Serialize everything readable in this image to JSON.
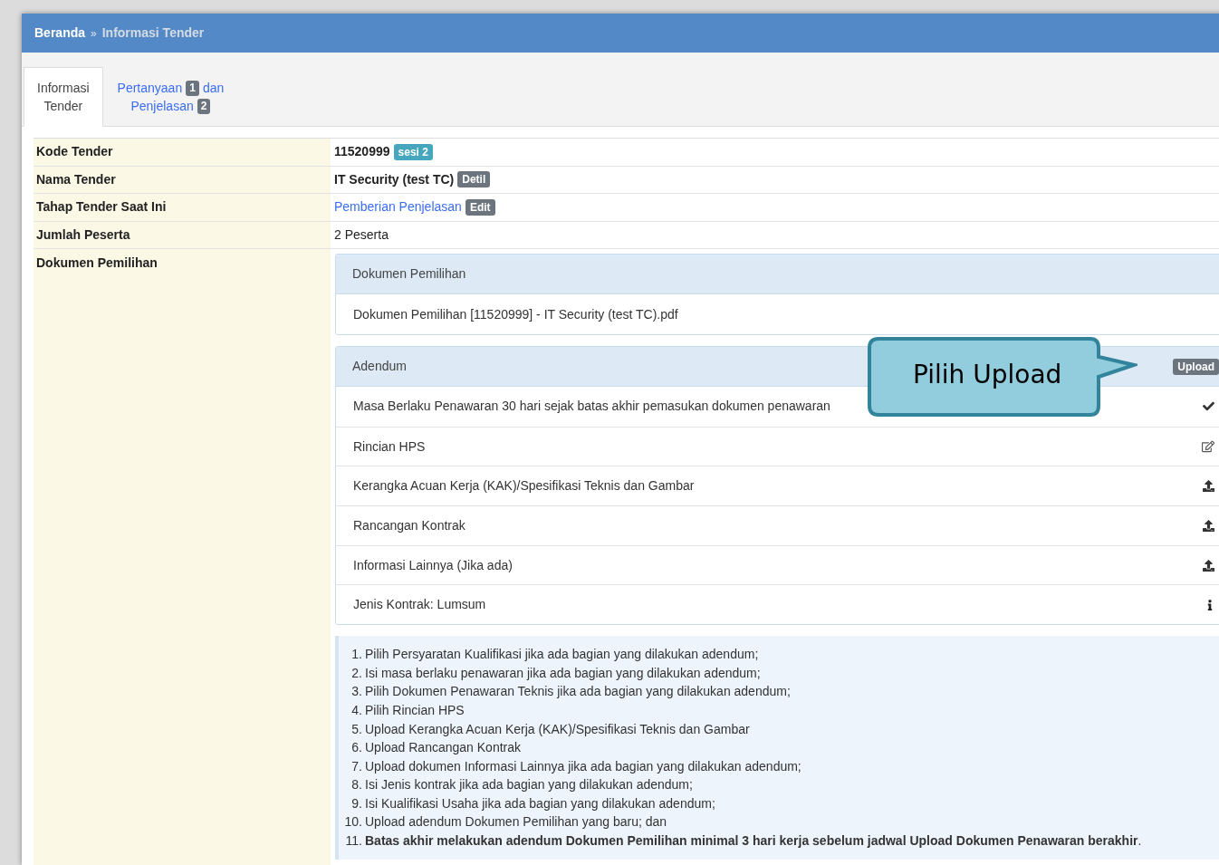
{
  "breadcrumb": {
    "home": "Beranda",
    "separator": "»",
    "current": "Informasi Tender"
  },
  "tabs": [
    {
      "selected": true,
      "lines": [
        [
          {
            "kind": "text",
            "text": "Informasi"
          }
        ],
        [
          {
            "kind": "text",
            "text": "Tender"
          }
        ]
      ]
    },
    {
      "selected": false,
      "lines": [
        [
          {
            "kind": "text",
            "text": "Pertanyaan"
          },
          {
            "kind": "badge",
            "text": "1"
          },
          {
            "kind": "text",
            "text": "dan"
          }
        ],
        [
          {
            "kind": "text",
            "text": "Penjelasan"
          },
          {
            "kind": "badge",
            "text": "2"
          }
        ]
      ]
    }
  ],
  "info_rows": [
    {
      "label": "Kode Tender",
      "value": "11520999",
      "kind": "bold",
      "badge": {
        "text": "sesi 2",
        "color": "#45a6bd"
      }
    },
    {
      "label": "Nama Tender",
      "value": "IT Security (test TC)",
      "kind": "bold",
      "badge": {
        "text": "Detil",
        "color": "#6c757d"
      }
    },
    {
      "label": "Tahap Tender Saat Ini",
      "value": "Pemberian Penjelasan",
      "kind": "link",
      "badge": {
        "text": "Edit",
        "color": "#6c757d"
      }
    },
    {
      "label": "Jumlah Peserta",
      "value": "2 Peserta",
      "kind": "plain"
    }
  ],
  "documents": {
    "label": "Dokumen Pemilihan",
    "panel_title": "Dokumen Pemilihan",
    "file": "Dokumen Pemilihan [11520999] - IT Security (test TC).pdf",
    "adendum": {
      "title": "Adendum",
      "upload_button": "Upload",
      "items": [
        {
          "text": "Masa Berlaku Penawaran 30 hari sejak batas akhir pemasukan dokumen penawaran",
          "kind": "check"
        },
        {
          "text": "Rincian HPS",
          "kind": "edit"
        },
        {
          "text": "Kerangka Acuan Kerja (KAK)/Spesifikasi Teknis dan Gambar",
          "kind": "upload"
        },
        {
          "text": "Rancangan Kontrak",
          "kind": "upload"
        },
        {
          "text": "Informasi Lainnya (Jika ada)",
          "kind": "upload"
        },
        {
          "text": "Jenis Kontrak: Lumsum",
          "kind": "info"
        }
      ]
    },
    "notes": [
      {
        "number": "1.",
        "text": "Pilih Persyaratan Kualifikasi jika ada bagian yang dilakukan adendum;"
      },
      {
        "number": "2.",
        "text": "Isi masa berlaku penawaran jika ada bagian yang dilakukan adendum;"
      },
      {
        "number": "3.",
        "text": "Pilih Dokumen Penawaran Teknis jika ada bagian yang dilakukan adendum;"
      },
      {
        "number": "4.",
        "text": "Pilih Rincian HPS"
      },
      {
        "number": "5.",
        "text": "Upload Kerangka Acuan Kerja (KAK)/Spesifikasi Teknis dan Gambar"
      },
      {
        "number": "6.",
        "text": "Upload Rancangan Kontrak"
      },
      {
        "number": "7.",
        "text": "Upload dokumen Informasi Lainnya jika ada bagian yang dilakukan adendum;"
      },
      {
        "number": "8.",
        "text": "Isi Jenis kontrak jika ada bagian yang dilakukan adendum;"
      },
      {
        "number": "9.",
        "text": "Isi Kualifikasi Usaha jika ada bagian yang dilakukan adendum;"
      },
      {
        "number": "10.",
        "text": "Upload adendum Dokumen Pemilihan yang baru; dan"
      },
      {
        "number": "11.",
        "text": "**Batas akhir melakukan adendum Dokumen Pemilihan minimal 3 hari kerja sebelum jadwal Upload Dokumen Penawaran berakhir**."
      }
    ]
  },
  "callout": {
    "text": "Pilih Upload"
  }
}
